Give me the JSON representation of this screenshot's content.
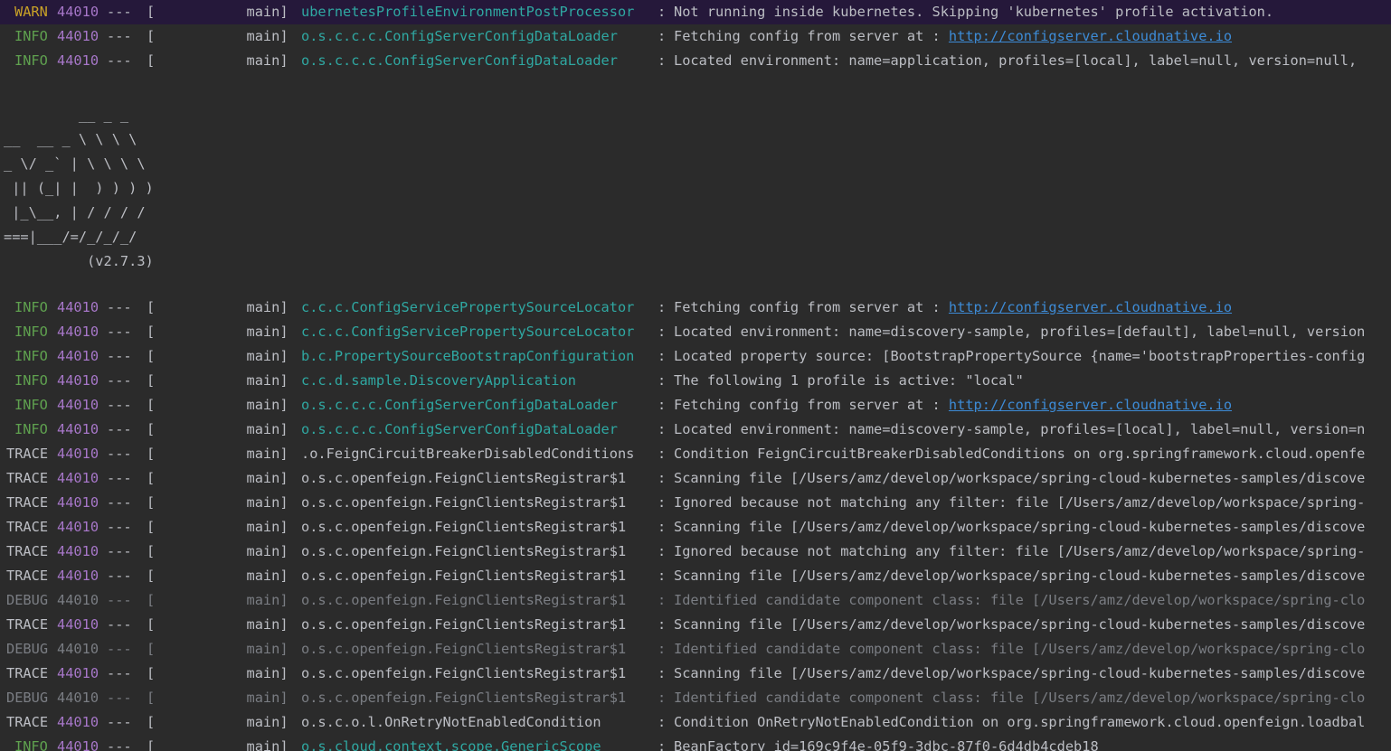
{
  "colors": {
    "background": "#2b2b2b",
    "warn": "#c9a227",
    "info": "#5fa14f",
    "pid": "#a777c9",
    "logger": "#2fa8a2",
    "link": "#3d8bd6",
    "debug": "#7a7d83",
    "highlight_row": "#25183a"
  },
  "lines_top": [
    {
      "level": "WARN",
      "pid": "44010",
      "sep": "---",
      "thread": "[           main]",
      "logger": "ubernetesProfileEnvironmentPostProcessor",
      "colon": ":",
      "message": "Not running inside kubernetes. Skipping 'kubernetes' profile activation."
    },
    {
      "level": "INFO",
      "pid": "44010",
      "sep": "---",
      "thread": "[           main]",
      "logger": "o.s.c.c.c.ConfigServerConfigDataLoader",
      "colon": ":",
      "message": "Fetching config from server at : ",
      "link": "http://configserver.cloudnative.io"
    },
    {
      "level": "INFO",
      "pid": "44010",
      "sep": "---",
      "thread": "[           main]",
      "logger": "o.s.c.c.c.ConfigServerConfigDataLoader",
      "colon": ":",
      "message": "Located environment: name=application, profiles=[local], label=null, version=null,"
    }
  ],
  "banner": [
    "         __ _ _",
    "__  __ _ \\ \\ \\ \\",
    "_ \\/ _` | \\ \\ \\ \\",
    " || (_| |  ) ) ) )",
    " |_\\__, | / / / /",
    "===|___/=/_/_/_/",
    "          (v2.7.3)"
  ],
  "lines_bottom": [
    {
      "level": "INFO",
      "pid": "44010",
      "sep": "---",
      "thread": "[           main]",
      "logger": "c.c.c.ConfigServicePropertySourceLocator",
      "colon": ":",
      "message": "Fetching config from server at : ",
      "link": "http://configserver.cloudnative.io"
    },
    {
      "level": "INFO",
      "pid": "44010",
      "sep": "---",
      "thread": "[           main]",
      "logger": "c.c.c.ConfigServicePropertySourceLocator",
      "colon": ":",
      "message": "Located environment: name=discovery-sample, profiles=[default], label=null, version"
    },
    {
      "level": "INFO",
      "pid": "44010",
      "sep": "---",
      "thread": "[           main]",
      "logger": "b.c.PropertySourceBootstrapConfiguration",
      "colon": ":",
      "message": "Located property source: [BootstrapPropertySource {name='bootstrapProperties-config"
    },
    {
      "level": "INFO",
      "pid": "44010",
      "sep": "---",
      "thread": "[           main]",
      "logger": "c.c.d.sample.DiscoveryApplication",
      "colon": ":",
      "message": "The following 1 profile is active: \"local\""
    },
    {
      "level": "INFO",
      "pid": "44010",
      "sep": "---",
      "thread": "[           main]",
      "logger": "o.s.c.c.c.ConfigServerConfigDataLoader",
      "colon": ":",
      "message": "Fetching config from server at : ",
      "link": "http://configserver.cloudnative.io"
    },
    {
      "level": "INFO",
      "pid": "44010",
      "sep": "---",
      "thread": "[           main]",
      "logger": "o.s.c.c.c.ConfigServerConfigDataLoader",
      "colon": ":",
      "message": "Located environment: name=discovery-sample, profiles=[local], label=null, version=n"
    },
    {
      "level": "TRACE",
      "pid": "44010",
      "sep": "---",
      "thread": "[           main]",
      "logger": ".o.FeignCircuitBreakerDisabledConditions",
      "colon": ":",
      "message": "Condition FeignCircuitBreakerDisabledConditions on org.springframework.cloud.openfe"
    },
    {
      "level": "TRACE",
      "pid": "44010",
      "sep": "---",
      "thread": "[           main]",
      "logger": "o.s.c.openfeign.FeignClientsRegistrar$1",
      "colon": ":",
      "message": "Scanning file [/Users/amz/develop/workspace/spring-cloud-kubernetes-samples/discove"
    },
    {
      "level": "TRACE",
      "pid": "44010",
      "sep": "---",
      "thread": "[           main]",
      "logger": "o.s.c.openfeign.FeignClientsRegistrar$1",
      "colon": ":",
      "message": "Ignored because not matching any filter: file [/Users/amz/develop/workspace/spring-"
    },
    {
      "level": "TRACE",
      "pid": "44010",
      "sep": "---",
      "thread": "[           main]",
      "logger": "o.s.c.openfeign.FeignClientsRegistrar$1",
      "colon": ":",
      "message": "Scanning file [/Users/amz/develop/workspace/spring-cloud-kubernetes-samples/discove"
    },
    {
      "level": "TRACE",
      "pid": "44010",
      "sep": "---",
      "thread": "[           main]",
      "logger": "o.s.c.openfeign.FeignClientsRegistrar$1",
      "colon": ":",
      "message": "Ignored because not matching any filter: file [/Users/amz/develop/workspace/spring-"
    },
    {
      "level": "TRACE",
      "pid": "44010",
      "sep": "---",
      "thread": "[           main]",
      "logger": "o.s.c.openfeign.FeignClientsRegistrar$1",
      "colon": ":",
      "message": "Scanning file [/Users/amz/develop/workspace/spring-cloud-kubernetes-samples/discove"
    },
    {
      "level": "DEBUG",
      "pid": "44010",
      "sep": "---",
      "thread": "[           main]",
      "logger": "o.s.c.openfeign.FeignClientsRegistrar$1",
      "colon": ":",
      "message": "Identified candidate component class: file [/Users/amz/develop/workspace/spring-clo"
    },
    {
      "level": "TRACE",
      "pid": "44010",
      "sep": "---",
      "thread": "[           main]",
      "logger": "o.s.c.openfeign.FeignClientsRegistrar$1",
      "colon": ":",
      "message": "Scanning file [/Users/amz/develop/workspace/spring-cloud-kubernetes-samples/discove"
    },
    {
      "level": "DEBUG",
      "pid": "44010",
      "sep": "---",
      "thread": "[           main]",
      "logger": "o.s.c.openfeign.FeignClientsRegistrar$1",
      "colon": ":",
      "message": "Identified candidate component class: file [/Users/amz/develop/workspace/spring-clo"
    },
    {
      "level": "TRACE",
      "pid": "44010",
      "sep": "---",
      "thread": "[           main]",
      "logger": "o.s.c.openfeign.FeignClientsRegistrar$1",
      "colon": ":",
      "message": "Scanning file [/Users/amz/develop/workspace/spring-cloud-kubernetes-samples/discove"
    },
    {
      "level": "DEBUG",
      "pid": "44010",
      "sep": "---",
      "thread": "[           main]",
      "logger": "o.s.c.openfeign.FeignClientsRegistrar$1",
      "colon": ":",
      "message": "Identified candidate component class: file [/Users/amz/develop/workspace/spring-clo"
    },
    {
      "level": "TRACE",
      "pid": "44010",
      "sep": "---",
      "thread": "[           main]",
      "logger": "o.s.c.o.l.OnRetryNotEnabledCondition",
      "colon": ":",
      "message": "Condition OnRetryNotEnabledCondition on org.springframework.cloud.openfeign.loadbal"
    },
    {
      "level": "INFO",
      "pid": "44010",
      "sep": "---",
      "thread": "[           main]",
      "logger": "o.s.cloud.context.scope.GenericScope",
      "colon": ":",
      "message": "BeanFactory id=169c9f4e-05f9-3dbc-87f0-6d4db4cdeb18"
    }
  ]
}
